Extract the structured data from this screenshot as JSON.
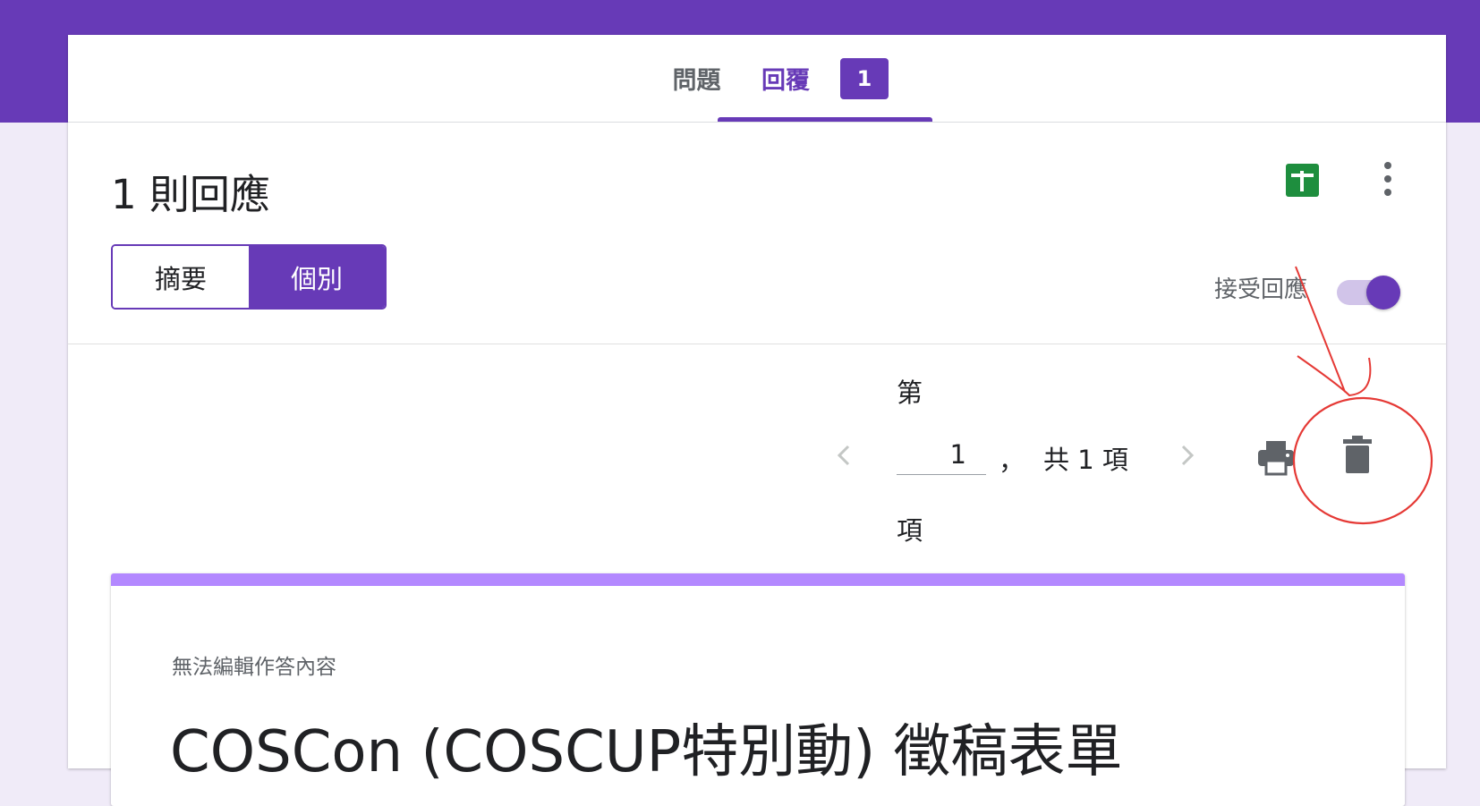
{
  "tabs": {
    "questions": "問題",
    "responses": "回覆",
    "responses_badge": "1"
  },
  "summary": {
    "title": "1 則回應",
    "view_toggle": {
      "summary_label": "摘要",
      "individual_label": "個別",
      "selected": "個別"
    },
    "accepting_label": "接受回應",
    "accepting_on": true,
    "icons": [
      "sheets-icon",
      "more-vert-icon"
    ]
  },
  "pager": {
    "prefix": "第",
    "current": "1",
    "comma": "，",
    "total_text": "共 1 項",
    "suffix": "項",
    "icons": [
      "chevron-left-icon",
      "chevron-right-icon",
      "print-icon",
      "trash-icon"
    ]
  },
  "response": {
    "notice": "無法編輯作答內容",
    "form_title": "COSCon (COSCUP特別動) 徵稿表單"
  },
  "colors": {
    "brand": "#673ab7",
    "background": "#f0ebf8",
    "sheet_accent": "#b388ff",
    "sheets_green": "#1e8e3e",
    "annotation_red": "#e53935"
  }
}
